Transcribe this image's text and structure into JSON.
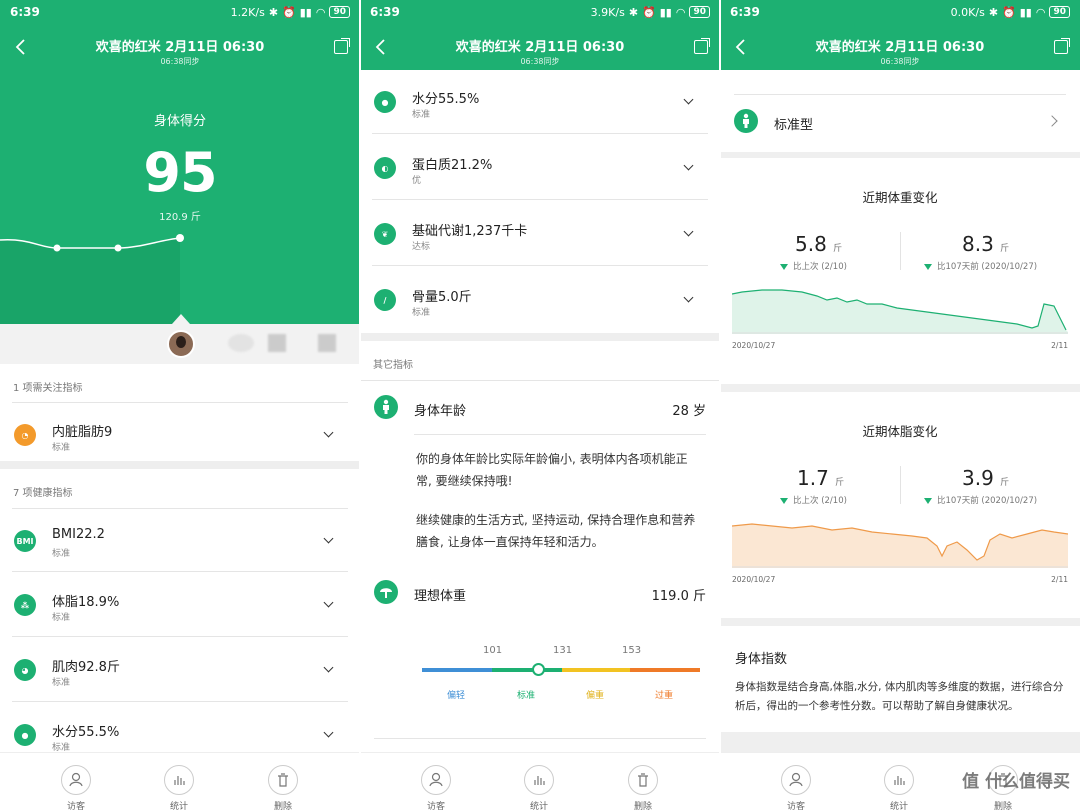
{
  "status": {
    "p1": {
      "time": "6:39",
      "speed": "1.2K/s",
      "battery": "90"
    },
    "p2": {
      "time": "6:39",
      "speed": "3.9K/s",
      "battery": "90"
    },
    "p3": {
      "time": "6:39",
      "speed": "0.0K/s",
      "battery": "90"
    }
  },
  "nav": {
    "title": "欢喜的红米 2月11日 06:30",
    "subtitle": "06:38同步"
  },
  "panel1": {
    "score_label": "身体得分",
    "score": "95",
    "weight": "120.9 斤",
    "attention_label": "1 项需关注指标",
    "attention_items": [
      {
        "name": "内脏脂肪9",
        "status": "标准"
      }
    ],
    "health_label": "7 项健康指标",
    "health_items": [
      {
        "name": "BMI22.2",
        "status": "标准",
        "icon_text": "BMI"
      },
      {
        "name": "体脂18.9%",
        "status": "标准"
      },
      {
        "name": "肌肉92.8斤",
        "status": "标准"
      },
      {
        "name": "水分55.5%",
        "status": "标准"
      }
    ]
  },
  "panel2": {
    "items": [
      {
        "name": "水分55.5%",
        "status": "标准"
      },
      {
        "name": "蛋白质21.2%",
        "status": "优"
      },
      {
        "name": "基础代谢1,237千卡",
        "status": "达标"
      },
      {
        "name": "骨量5.0斤",
        "status": "标准"
      }
    ],
    "other_label": "其它指标",
    "body_age": {
      "label": "身体年龄",
      "value": "28 岁"
    },
    "body_age_desc1": "你的身体年龄比实际年龄偏小, 表明体内各项机能正常, 要继续保持哦!",
    "body_age_desc2": "继续健康的生活方式, 坚持运动, 保持合理作息和营养膳食, 让身体一直保持年轻和活力。",
    "ideal_weight": {
      "label": "理想体重",
      "value": "119.0 斤"
    },
    "scale_ticks": [
      "101",
      "131",
      "153"
    ],
    "scale_labels": [
      "偏轻",
      "标准",
      "偏重",
      "过重"
    ]
  },
  "panel3": {
    "body_type": "标准型",
    "weight_card": {
      "title": "近期体重变化",
      "left_value": "5.8",
      "left_unit": "斤",
      "left_cmp": "比上次 (2/10)",
      "right_value": "8.3",
      "right_unit": "斤",
      "right_cmp": "比107天前 (2020/10/27)",
      "date_start": "2020/10/27",
      "date_end": "2/11"
    },
    "fat_card": {
      "title": "近期体脂变化",
      "left_value": "1.7",
      "left_unit": "斤",
      "left_cmp": "比上次 (2/10)",
      "right_value": "3.9",
      "right_unit": "斤",
      "right_cmp": "比107天前 (2020/10/27)",
      "date_start": "2020/10/27",
      "date_end": "2/11"
    },
    "index_title": "身体指数",
    "index_desc": "身体指数是结合身高,体脂,水分, 体内肌肉等多维度的数据，进行综合分析后，得出的一个参考性分数。可以帮助了解自身健康状况。"
  },
  "bottom": {
    "visitor": "访客",
    "stats": "统计",
    "delete": "删除"
  },
  "watermark": "值 什么值得买",
  "colors": {
    "green": "#1db072",
    "orange": "#f39a2b",
    "blue": "#3f8fd6",
    "yellow": "#f2c322",
    "deep_orange": "#ef7a28"
  }
}
